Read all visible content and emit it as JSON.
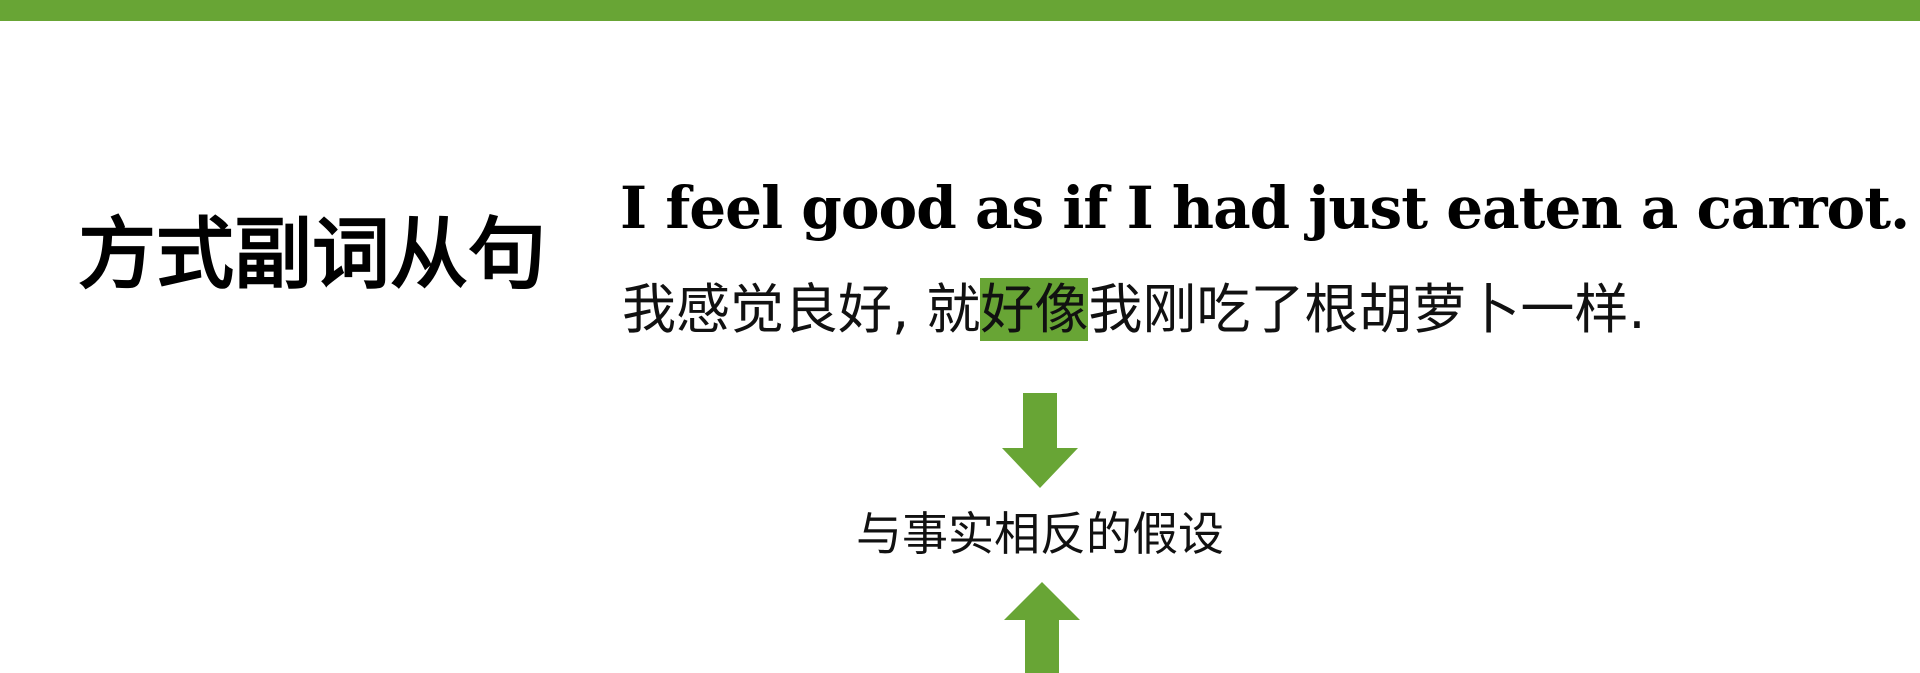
{
  "colors": {
    "accent": "#68a535",
    "text": "#000000"
  },
  "slide": {
    "topic_title": "方式副词从句",
    "english_sentence": "I feel good as if I had just eaten a carrot.",
    "chinese": {
      "before": "我感觉良好, 就",
      "highlight": "好像",
      "after": "我刚吃了根胡萝卜一样."
    },
    "center_label": "与事实相反的假设",
    "icons": {
      "down": "arrow-down-icon",
      "up": "arrow-up-icon"
    }
  }
}
